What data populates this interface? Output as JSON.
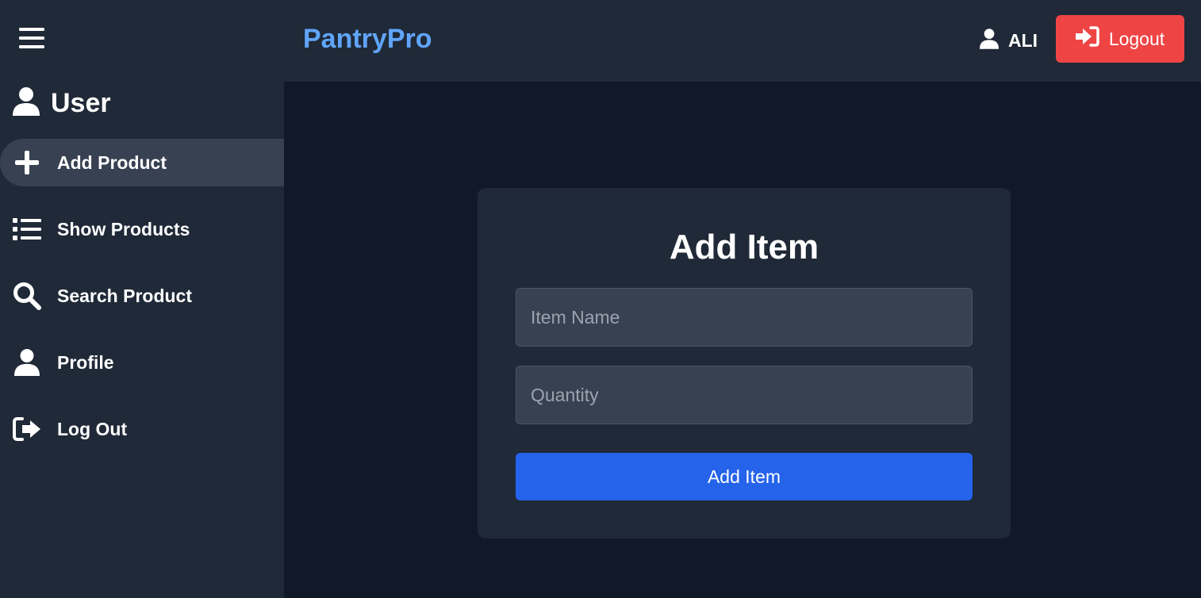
{
  "topbar": {
    "brand": "PantryPro",
    "user_icon": "user-icon",
    "username": "ALI",
    "logout_label": "Logout",
    "logout_icon": "sign-in-icon"
  },
  "sidebar": {
    "menu_icon": "hamburger-icon",
    "heading": "User",
    "heading_icon": "user-icon",
    "items": [
      {
        "label": "Add Product",
        "icon": "plus-icon",
        "active": true
      },
      {
        "label": "Show Products",
        "icon": "list-icon",
        "active": false
      },
      {
        "label": "Search Product",
        "icon": "search-icon",
        "active": false
      },
      {
        "label": "Profile",
        "icon": "user-icon",
        "active": false
      },
      {
        "label": "Log Out",
        "icon": "sign-out-icon",
        "active": false
      }
    ]
  },
  "form": {
    "title": "Add Item",
    "item_name": {
      "placeholder": "Item Name",
      "value": ""
    },
    "quantity": {
      "placeholder": "Quantity",
      "value": ""
    },
    "submit_label": "Add Item"
  },
  "colors": {
    "page_bg": "#111827",
    "panel_bg": "#1f2937",
    "active_bg": "#374151",
    "brand": "#60a5fa",
    "logout": "#ef4444",
    "primary": "#2563eb"
  }
}
